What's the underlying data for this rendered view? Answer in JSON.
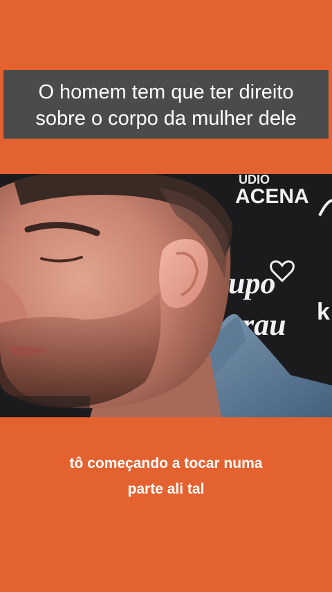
{
  "top_caption": {
    "line1": "O homem tem que ter direito",
    "line2": "sobre o corpo da mulher dele"
  },
  "video": {
    "backdrop_text": {
      "studio": "UDIO",
      "acena": "ACENA",
      "upo": "upo",
      "rau": "rau",
      "k": "k"
    }
  },
  "subtitle": {
    "line1": "tô começando a tocar numa",
    "line2": "parte ali tal"
  },
  "colors": {
    "background": "#e4622f",
    "caption_box": "#4b4b4b",
    "text": "#ffffff"
  }
}
